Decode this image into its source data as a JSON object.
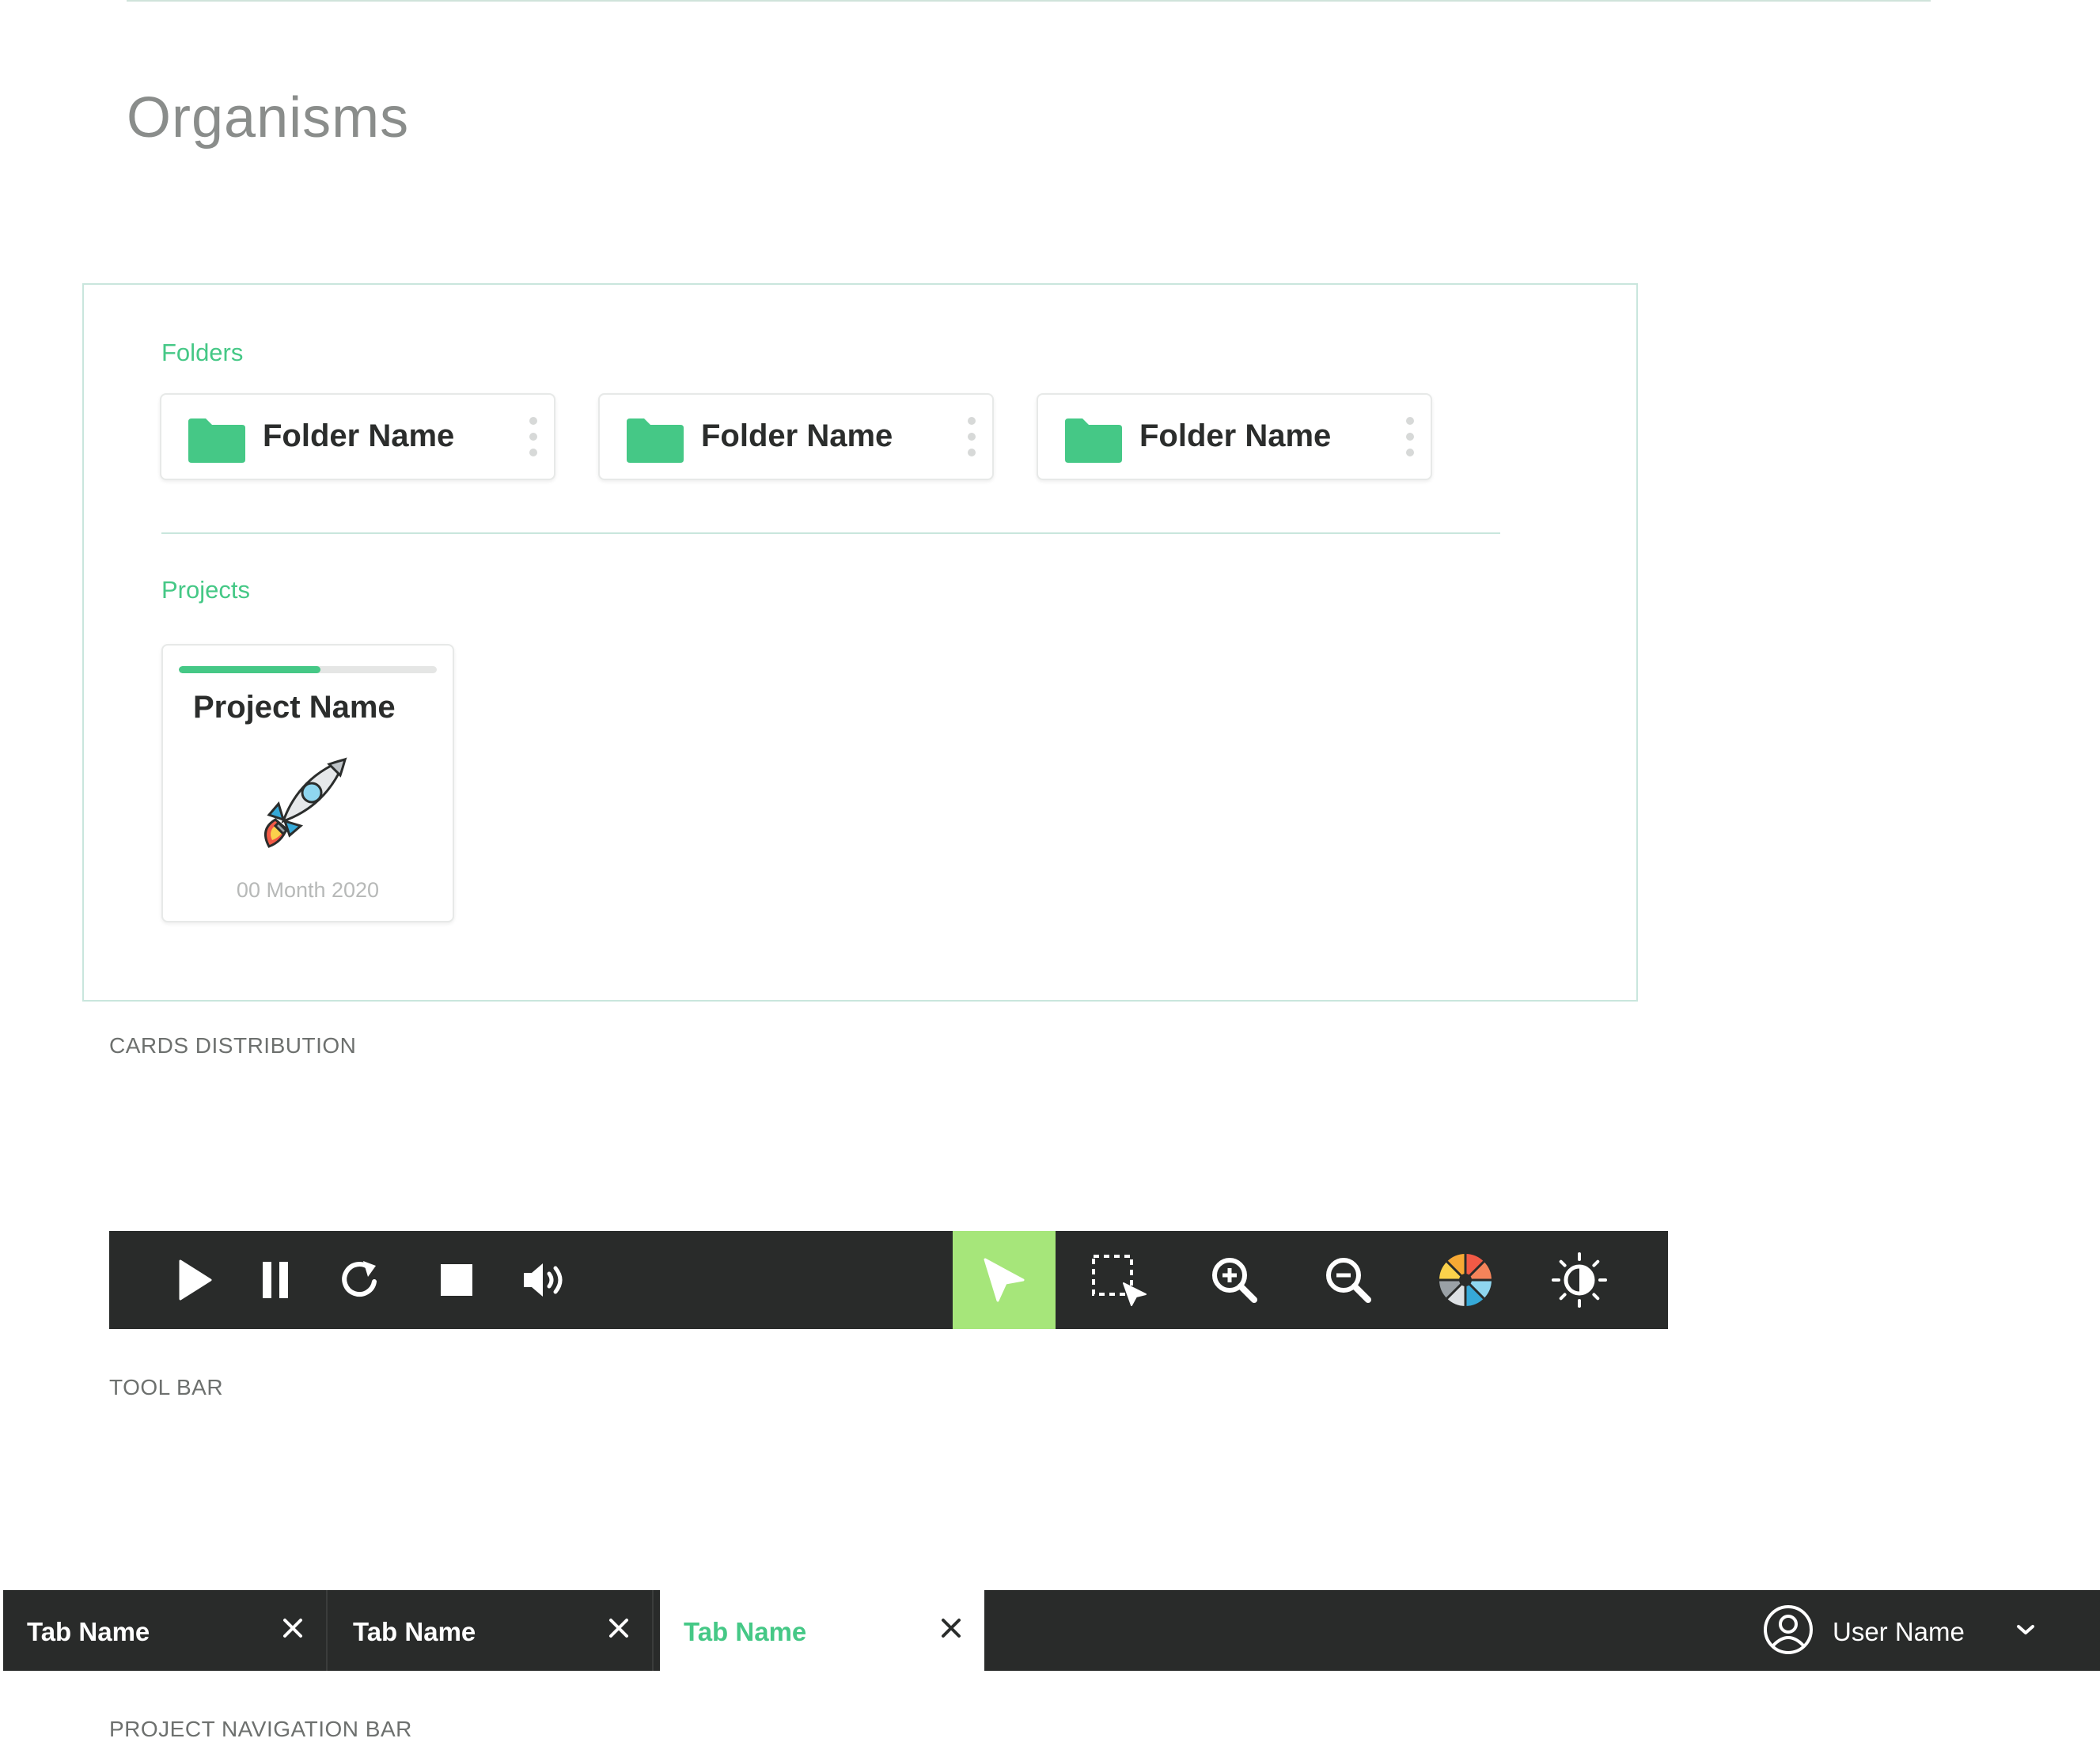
{
  "page": {
    "title": "Organisms"
  },
  "cards_section": {
    "folders_label": "Folders",
    "folders": [
      {
        "name": "Folder Name"
      },
      {
        "name": "Folder Name"
      },
      {
        "name": "Folder Name"
      }
    ],
    "projects_label": "Projects",
    "project": {
      "name": "Project Name",
      "date": "00 Month 2020",
      "progress": 0.55
    },
    "caption": "CARDS DISTRIBUTION"
  },
  "toolbar": {
    "tools": [
      "play-icon",
      "pause-icon",
      "refresh-icon",
      "stop-icon",
      "volume-icon",
      "cursor-icon",
      "select-area-icon",
      "zoom-in-icon",
      "zoom-out-icon",
      "color-wheel-icon",
      "brightness-icon"
    ],
    "active_tool": "cursor-icon",
    "caption": "TOOL BAR"
  },
  "nav": {
    "tabs": [
      {
        "label": "Tab Name",
        "active": false
      },
      {
        "label": "Tab Name",
        "active": false
      },
      {
        "label": "Tab Name",
        "active": true
      }
    ],
    "user_name": "User Name",
    "caption": "PROJECT NAVIGATION BAR"
  },
  "colors": {
    "accent": "#45c886",
    "active_tool": "#a6e67a",
    "dark": "#292b2a",
    "frame": "#c9e6dd"
  }
}
